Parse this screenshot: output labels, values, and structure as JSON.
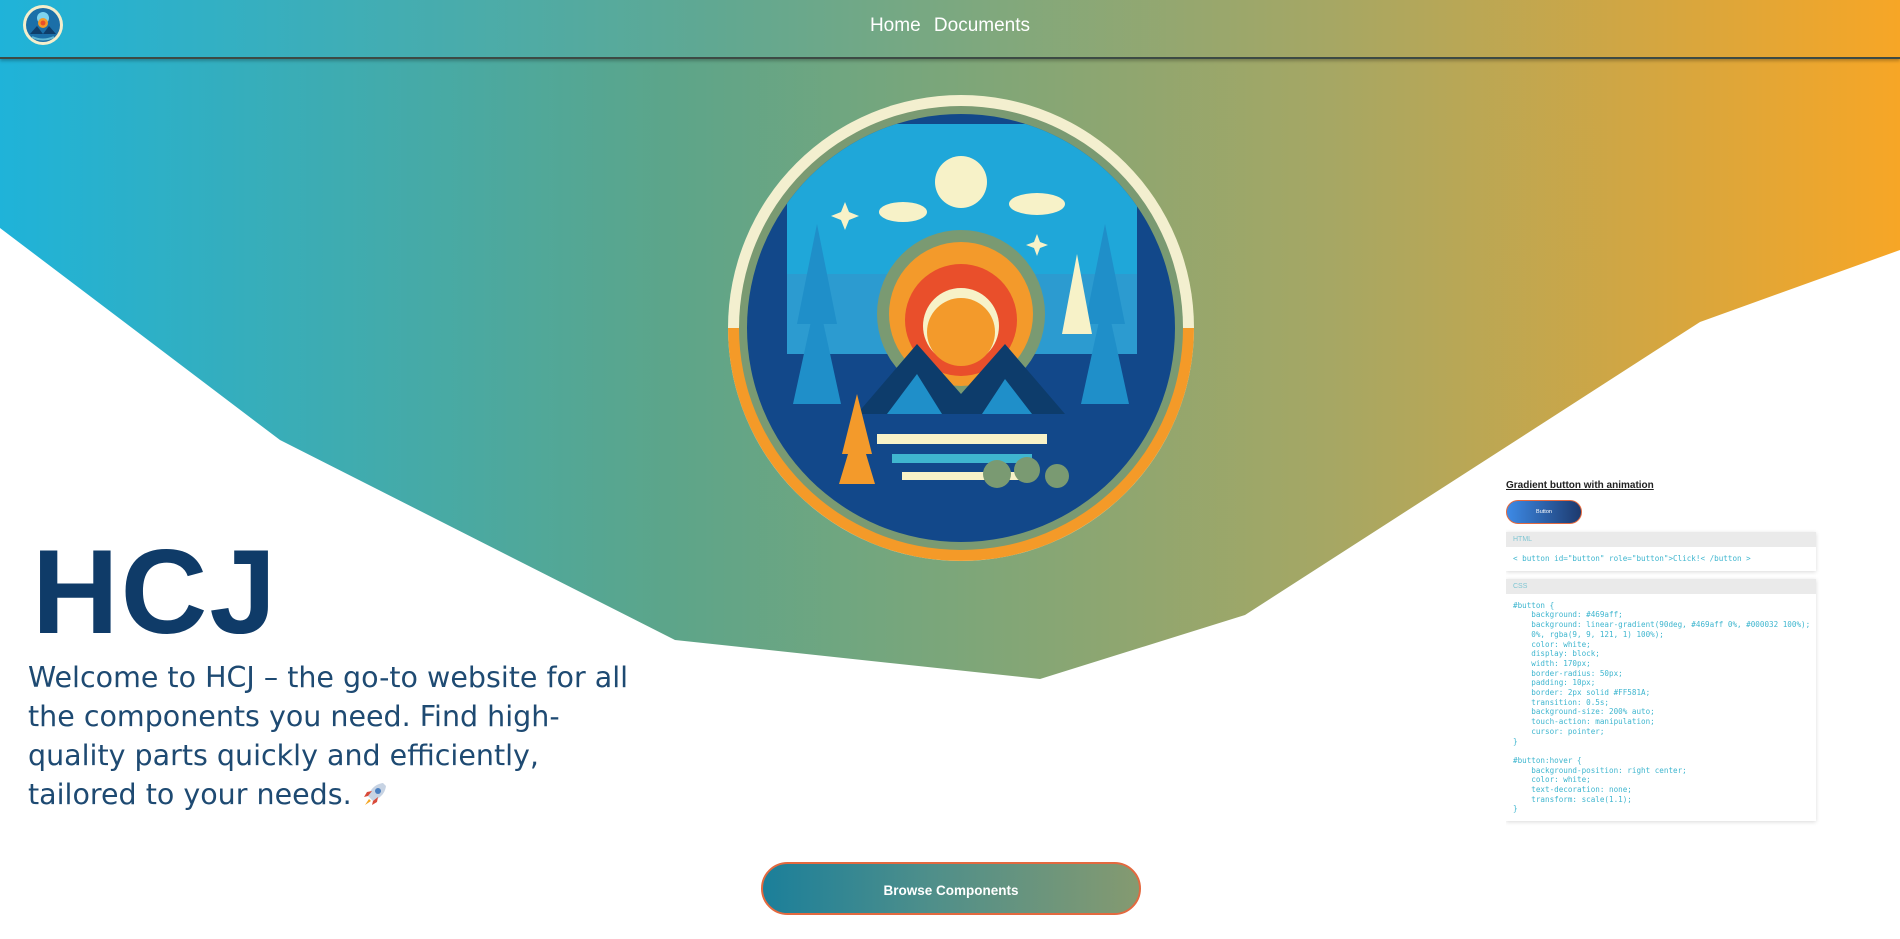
{
  "colors": {
    "brand_dark": "#0f3b68",
    "gradient_start": "#1fb3d9",
    "gradient_mid": "#5ca58a",
    "gradient_end": "#f7a626",
    "accent_orange": "#e3693f"
  },
  "navbar": {
    "logo_icon": "emblem-logo-icon",
    "links": [
      "Home",
      "Documents"
    ]
  },
  "hero": {
    "emblem_icon": "nature-emblem-icon",
    "title": "HCJ",
    "welcome_text": "Welcome to HCJ – the go-to website for all the components you need. Find high-quality parts quickly and efficiently, tailored to your needs.",
    "rocket_icon": "rocket-icon",
    "cta_label": "Browse Components"
  },
  "preview": {
    "title": "Gradient button with animation",
    "button_label": "Button",
    "html_header": "HTML",
    "html_code": "< button id=\"button\" role=\"button\">Click!< /button >",
    "css_header": "CSS",
    "css_code": "#button {\n    background: #469aff;\n    background: linear-gradient(90deg, #469aff 0%, #000032 100%);\n    0%, rgba(9, 9, 121, 1) 100%);\n    color: white;\n    display: block;\n    width: 170px;\n    border-radius: 50px;\n    padding: 10px;\n    border: 2px solid #FF581A;\n    transition: 0.5s;\n    background-size: 200% auto;\n    touch-action: manipulation;\n    cursor: pointer;\n}\n\n#button:hover {\n    background-position: right center;\n    color: white;\n    text-decoration: none;\n    transform: scale(1.1);\n}"
  }
}
